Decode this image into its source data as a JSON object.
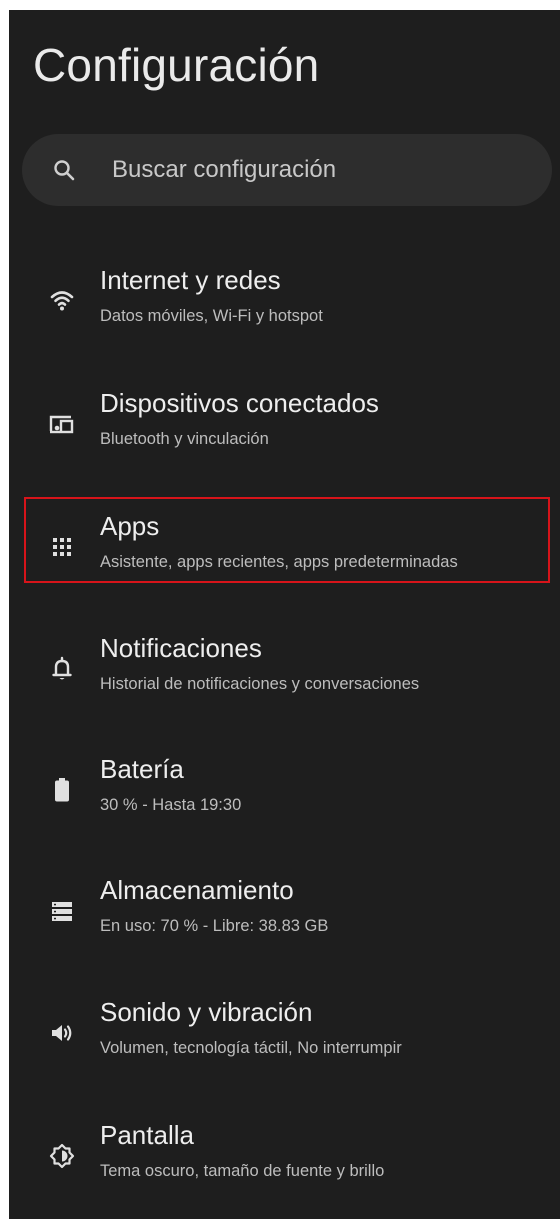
{
  "header": {
    "title": "Configuración"
  },
  "search": {
    "placeholder": "Buscar configuración",
    "icon": "search-icon"
  },
  "settings": [
    {
      "title": "Internet y redes",
      "subtitle": "Datos móviles, Wi-Fi y hotspot",
      "icon": "wifi-icon"
    },
    {
      "title": "Dispositivos conectados",
      "subtitle": "Bluetooth y vinculación",
      "icon": "connected-devices-icon"
    },
    {
      "title": "Apps",
      "subtitle": "Asistente, apps recientes, apps predeterminadas",
      "icon": "apps-grid-icon",
      "highlighted": true
    },
    {
      "title": "Notificaciones",
      "subtitle": "Historial de notificaciones y conversaciones",
      "icon": "bell-icon"
    },
    {
      "title": "Batería",
      "subtitle": "30 % - Hasta 19:30",
      "icon": "battery-icon"
    },
    {
      "title": "Almacenamiento",
      "subtitle": "En uso: 70 % - Libre: 38.83 GB",
      "icon": "storage-icon"
    },
    {
      "title": "Sonido y vibración",
      "subtitle": "Volumen, tecnología táctil, No interrumpir",
      "icon": "volume-icon"
    },
    {
      "title": "Pantalla",
      "subtitle": "Tema oscuro, tamaño de fuente y brillo",
      "icon": "display-brightness-icon"
    }
  ],
  "colors": {
    "background": "#1e1e1e",
    "search_bg": "#2d2d2d",
    "text": "#eeeeee",
    "subtext": "#bdbdbd",
    "highlight": "#d7141a"
  }
}
